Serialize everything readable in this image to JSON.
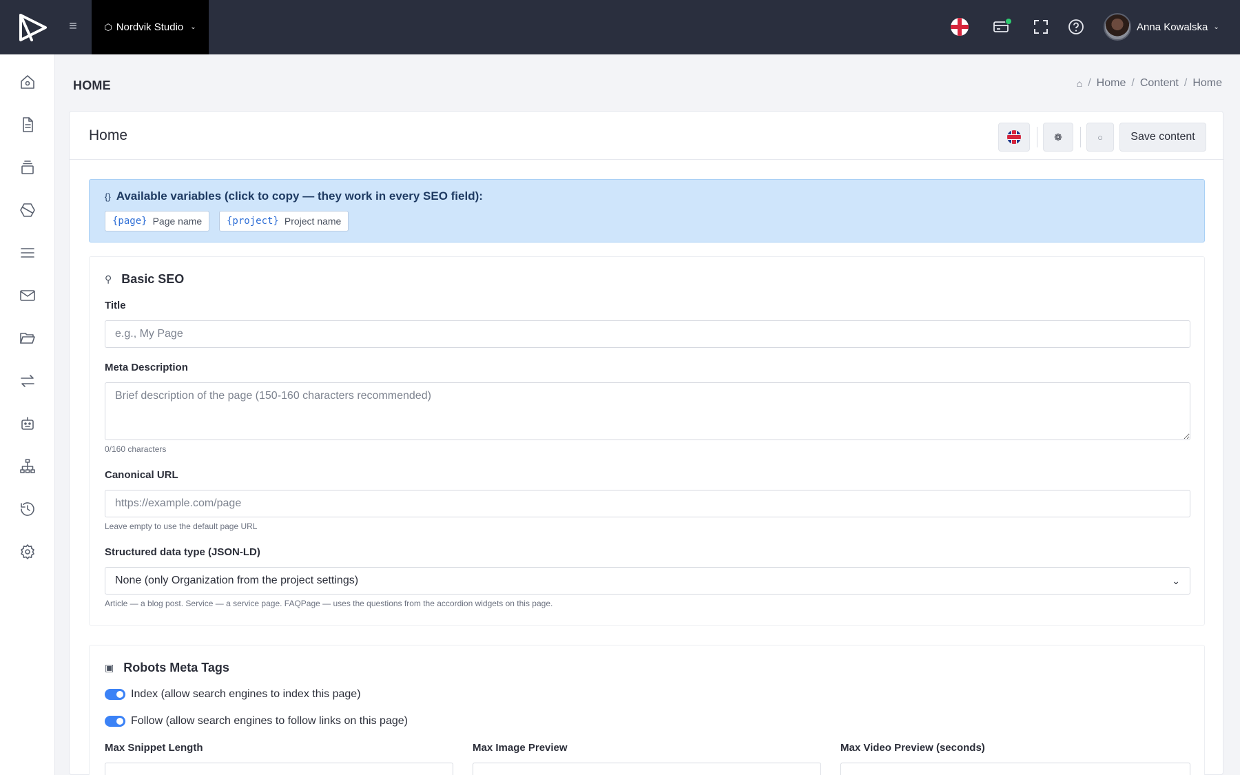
{
  "topbar": {
    "org_name": "Nordvik Studio",
    "user_name": "Anna Kowalska",
    "colors": {
      "background": "#2a2f3e",
      "org_bg": "#000000",
      "notification": "#2ecc71"
    }
  },
  "page": {
    "heading": "HOME",
    "breadcrumb": [
      "Home",
      "Content",
      "Home"
    ]
  },
  "card": {
    "title": "Home",
    "save_label": "Save content"
  },
  "variables": {
    "title": "Available variables (click to copy — they work in every SEO field):",
    "items": [
      {
        "code": "{page}",
        "desc": "Page name"
      },
      {
        "code": "{project}",
        "desc": "Project name"
      }
    ]
  },
  "basic_seo": {
    "title": "Basic SEO",
    "title_label": "Title",
    "title_placeholder": "e.g., My Page",
    "meta_label": "Meta Description",
    "meta_placeholder": "Brief description of the page (150-160 characters recommended)",
    "meta_counter": "0/160 characters",
    "canonical_label": "Canonical URL",
    "canonical_placeholder": "https://example.com/page",
    "canonical_hint": "Leave empty to use the default page URL",
    "schema_label": "Structured data type (JSON-LD)",
    "schema_value": "None (only Organization from the project settings)",
    "schema_hint": "Article — a blog post. Service — a service page. FAQPage — uses the questions from the accordion widgets on this page."
  },
  "robots": {
    "title": "Robots Meta Tags",
    "index_label": "Index (allow search engines to index this page)",
    "index_on": true,
    "follow_label": "Follow (allow search engines to follow links on this page)",
    "follow_on": true,
    "snippet_label": "Max Snippet Length",
    "image_label": "Max Image Preview",
    "video_label": "Max Video Preview (seconds)"
  },
  "accent": "#3b82f6"
}
